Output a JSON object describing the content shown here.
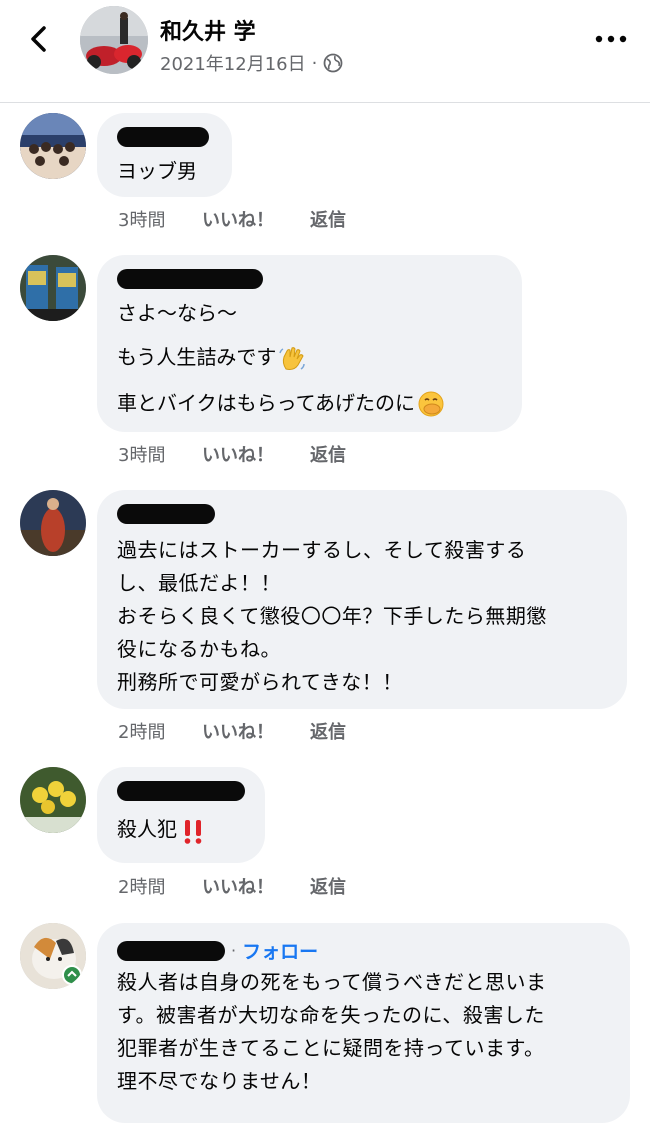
{
  "header": {
    "name": "和久井 学",
    "date": "2021年12月16日",
    "separator": "·",
    "privacy_icon": "globe-icon",
    "back_icon": "chevron-left-icon",
    "more_icon": "more-horizontal-icon"
  },
  "comments": [
    {
      "lines": [
        "ヨッブ男"
      ],
      "time": "3時間",
      "like": "いいね！",
      "reply": "返信"
    },
    {
      "lines": [
        "さよ〜なら〜",
        "もう人生詰みです",
        "車とバイクはもらってあげたのに"
      ],
      "emojis": [
        "waving-hand-emoji",
        "face-with-hand-over-mouth-emoji"
      ],
      "time": "3時間",
      "like": "いいね！",
      "reply": "返信"
    },
    {
      "text": "過去にはストーカーするし、そして殺害する\nし、最低だよ！！\nおそらく良くて懲役〇〇年？下手したら無期懲\n役になるかもね。\n刑務所で可愛がられてきな！！",
      "time": "2時間",
      "like": "いいね！",
      "reply": "返信"
    },
    {
      "text": "殺人犯",
      "emojis": [
        "double-exclamation-emoji"
      ],
      "time": "2時間",
      "like": "いいね！",
      "reply": "返信"
    },
    {
      "follow_separator": "·",
      "follow": "フォロー",
      "text": "殺人者は自身の死をもって償うべきだと思いま\nす。被害者が大切な命を失ったのに、殺害した\n犯罪者が生きてることに疑問を持っています。\n理不尽でなりません！"
    }
  ],
  "colors": {
    "bubble": "#f0f2f5",
    "meta_text": "#65676b",
    "link": "#1877f2",
    "redaction": "#0a0a0a"
  }
}
